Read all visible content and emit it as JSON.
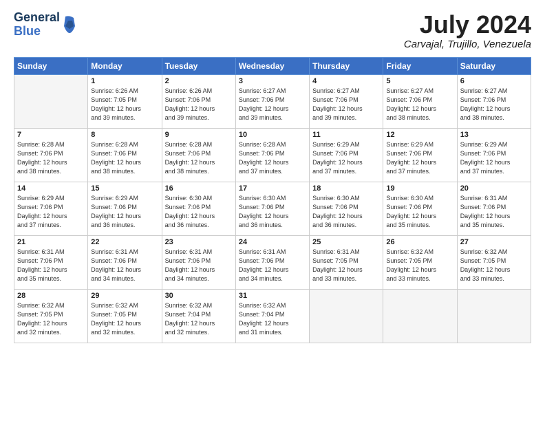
{
  "header": {
    "logo_line1": "General",
    "logo_line2": "Blue",
    "month_title": "July 2024",
    "location": "Carvajal, Trujillo, Venezuela"
  },
  "days_of_week": [
    "Sunday",
    "Monday",
    "Tuesday",
    "Wednesday",
    "Thursday",
    "Friday",
    "Saturday"
  ],
  "weeks": [
    [
      {
        "day": "",
        "info": ""
      },
      {
        "day": "1",
        "info": "Sunrise: 6:26 AM\nSunset: 7:05 PM\nDaylight: 12 hours\nand 39 minutes."
      },
      {
        "day": "2",
        "info": "Sunrise: 6:26 AM\nSunset: 7:06 PM\nDaylight: 12 hours\nand 39 minutes."
      },
      {
        "day": "3",
        "info": "Sunrise: 6:27 AM\nSunset: 7:06 PM\nDaylight: 12 hours\nand 39 minutes."
      },
      {
        "day": "4",
        "info": "Sunrise: 6:27 AM\nSunset: 7:06 PM\nDaylight: 12 hours\nand 39 minutes."
      },
      {
        "day": "5",
        "info": "Sunrise: 6:27 AM\nSunset: 7:06 PM\nDaylight: 12 hours\nand 38 minutes."
      },
      {
        "day": "6",
        "info": "Sunrise: 6:27 AM\nSunset: 7:06 PM\nDaylight: 12 hours\nand 38 minutes."
      }
    ],
    [
      {
        "day": "7",
        "info": "Sunrise: 6:28 AM\nSunset: 7:06 PM\nDaylight: 12 hours\nand 38 minutes."
      },
      {
        "day": "8",
        "info": "Sunrise: 6:28 AM\nSunset: 7:06 PM\nDaylight: 12 hours\nand 38 minutes."
      },
      {
        "day": "9",
        "info": "Sunrise: 6:28 AM\nSunset: 7:06 PM\nDaylight: 12 hours\nand 38 minutes."
      },
      {
        "day": "10",
        "info": "Sunrise: 6:28 AM\nSunset: 7:06 PM\nDaylight: 12 hours\nand 37 minutes."
      },
      {
        "day": "11",
        "info": "Sunrise: 6:29 AM\nSunset: 7:06 PM\nDaylight: 12 hours\nand 37 minutes."
      },
      {
        "day": "12",
        "info": "Sunrise: 6:29 AM\nSunset: 7:06 PM\nDaylight: 12 hours\nand 37 minutes."
      },
      {
        "day": "13",
        "info": "Sunrise: 6:29 AM\nSunset: 7:06 PM\nDaylight: 12 hours\nand 37 minutes."
      }
    ],
    [
      {
        "day": "14",
        "info": "Sunrise: 6:29 AM\nSunset: 7:06 PM\nDaylight: 12 hours\nand 37 minutes."
      },
      {
        "day": "15",
        "info": "Sunrise: 6:29 AM\nSunset: 7:06 PM\nDaylight: 12 hours\nand 36 minutes."
      },
      {
        "day": "16",
        "info": "Sunrise: 6:30 AM\nSunset: 7:06 PM\nDaylight: 12 hours\nand 36 minutes."
      },
      {
        "day": "17",
        "info": "Sunrise: 6:30 AM\nSunset: 7:06 PM\nDaylight: 12 hours\nand 36 minutes."
      },
      {
        "day": "18",
        "info": "Sunrise: 6:30 AM\nSunset: 7:06 PM\nDaylight: 12 hours\nand 36 minutes."
      },
      {
        "day": "19",
        "info": "Sunrise: 6:30 AM\nSunset: 7:06 PM\nDaylight: 12 hours\nand 35 minutes."
      },
      {
        "day": "20",
        "info": "Sunrise: 6:31 AM\nSunset: 7:06 PM\nDaylight: 12 hours\nand 35 minutes."
      }
    ],
    [
      {
        "day": "21",
        "info": "Sunrise: 6:31 AM\nSunset: 7:06 PM\nDaylight: 12 hours\nand 35 minutes."
      },
      {
        "day": "22",
        "info": "Sunrise: 6:31 AM\nSunset: 7:06 PM\nDaylight: 12 hours\nand 34 minutes."
      },
      {
        "day": "23",
        "info": "Sunrise: 6:31 AM\nSunset: 7:06 PM\nDaylight: 12 hours\nand 34 minutes."
      },
      {
        "day": "24",
        "info": "Sunrise: 6:31 AM\nSunset: 7:06 PM\nDaylight: 12 hours\nand 34 minutes."
      },
      {
        "day": "25",
        "info": "Sunrise: 6:31 AM\nSunset: 7:05 PM\nDaylight: 12 hours\nand 33 minutes."
      },
      {
        "day": "26",
        "info": "Sunrise: 6:32 AM\nSunset: 7:05 PM\nDaylight: 12 hours\nand 33 minutes."
      },
      {
        "day": "27",
        "info": "Sunrise: 6:32 AM\nSunset: 7:05 PM\nDaylight: 12 hours\nand 33 minutes."
      }
    ],
    [
      {
        "day": "28",
        "info": "Sunrise: 6:32 AM\nSunset: 7:05 PM\nDaylight: 12 hours\nand 32 minutes."
      },
      {
        "day": "29",
        "info": "Sunrise: 6:32 AM\nSunset: 7:05 PM\nDaylight: 12 hours\nand 32 minutes."
      },
      {
        "day": "30",
        "info": "Sunrise: 6:32 AM\nSunset: 7:04 PM\nDaylight: 12 hours\nand 32 minutes."
      },
      {
        "day": "31",
        "info": "Sunrise: 6:32 AM\nSunset: 7:04 PM\nDaylight: 12 hours\nand 31 minutes."
      },
      {
        "day": "",
        "info": ""
      },
      {
        "day": "",
        "info": ""
      },
      {
        "day": "",
        "info": ""
      }
    ]
  ]
}
